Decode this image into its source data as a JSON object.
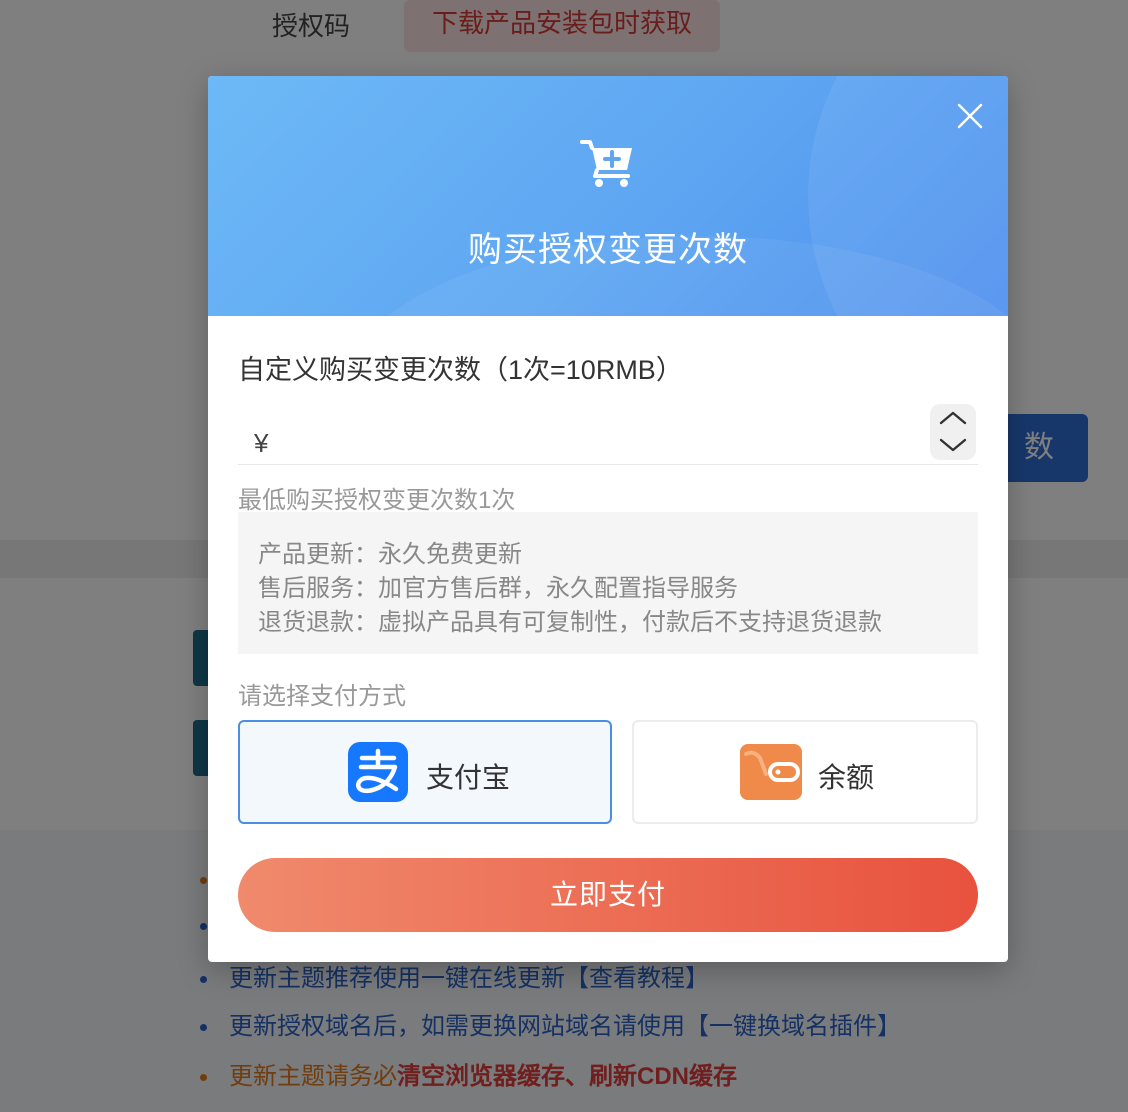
{
  "background": {
    "auth_code_label": "授权码",
    "auth_code_value": "下载产品安装包时获取",
    "side_button_text": "数",
    "notes": [
      {
        "text": "更新主题推荐使用一键在线更新【查看教程】",
        "color": "blue"
      },
      {
        "text": "更新授权域名后，如需更换网站域名请使用【一键换域名插件】",
        "color": "blue"
      },
      {
        "text_prefix": "更新主题请务必",
        "text_highlight": "清空浏览器缓存、刷新CDN缓存",
        "color": "orange"
      }
    ]
  },
  "modal": {
    "title": "购买授权变更次数",
    "close_icon": "close-icon",
    "header_icon": "cart-plus-icon",
    "field_label": "自定义购买变更次数（1次=10RMB）",
    "currency_symbol": "¥",
    "amount_value": "",
    "min_hint": "最低购买授权变更次数1次",
    "info_lines": [
      "产品更新：永久免费更新",
      "售后服务：加官方售后群，永久配置指导服务",
      "退货退款：虚拟产品具有可复制性，付款后不支持退货退款"
    ],
    "payment_label": "请选择支付方式",
    "payment_methods": [
      {
        "name": "支付宝",
        "icon": "alipay-icon",
        "selected": true
      },
      {
        "name": "余额",
        "icon": "wallet-icon",
        "selected": false
      }
    ],
    "pay_button": "立即支付"
  },
  "colors": {
    "header_start": "#6db9f6",
    "header_end": "#4f90ee",
    "selected_border": "#4a8ee4",
    "pay_start": "#f08a6c",
    "pay_end": "#e8523e",
    "alipay_blue": "#1677ff",
    "wallet_orange": "#f08a4b"
  }
}
